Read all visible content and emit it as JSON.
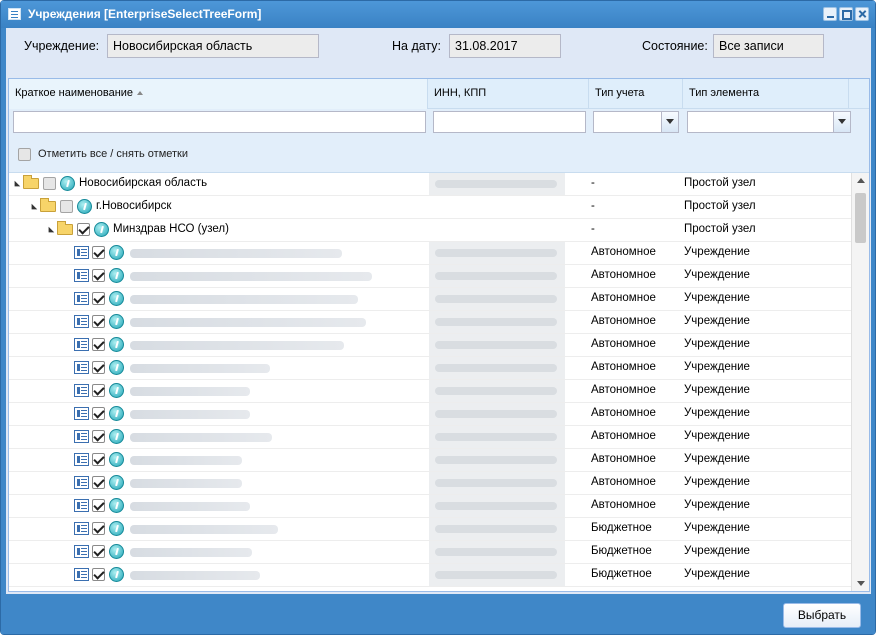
{
  "window": {
    "title": "Учреждения [EnterpriseSelectTreeForm]"
  },
  "filters": {
    "institution_label": "Учреждение:",
    "institution_value": "Новосибирская область",
    "date_label": "На дату:",
    "date_value": "31.08.2017",
    "state_label": "Состояние:",
    "state_value": "Все записи"
  },
  "grid": {
    "columns": [
      "Краткое наименование",
      "ИНН, КПП",
      "Тип учета",
      "Тип элемента"
    ],
    "sort_column": "Краткое наименование",
    "check_all_label": "Отметить все / снять отметки",
    "rows": [
      {
        "level": 0,
        "kind": "folder",
        "checked": false,
        "name": "Новосибирская область",
        "inn": "",
        "tip": "-",
        "type": "Простой узел"
      },
      {
        "level": 1,
        "kind": "folder",
        "checked": false,
        "name": "г.Новосибирск",
        "inn": "",
        "tip": "-",
        "type": "Простой узел"
      },
      {
        "level": 2,
        "kind": "folder",
        "checked": true,
        "name": "Минздрав НСО (узел)",
        "inn": "",
        "tip": "-",
        "type": "Простой узел"
      },
      {
        "level": 3,
        "kind": "leaf",
        "checked": true,
        "name": "",
        "inn": "",
        "tip": "Автономное",
        "type": "Учреждение"
      },
      {
        "level": 3,
        "kind": "leaf",
        "checked": true,
        "name": "",
        "inn": "",
        "tip": "Автономное",
        "type": "Учреждение"
      },
      {
        "level": 3,
        "kind": "leaf",
        "checked": true,
        "name": "",
        "inn": "",
        "tip": "Автономное",
        "type": "Учреждение"
      },
      {
        "level": 3,
        "kind": "leaf",
        "checked": true,
        "name": "",
        "inn": "",
        "tip": "Автономное",
        "type": "Учреждение"
      },
      {
        "level": 3,
        "kind": "leaf",
        "checked": true,
        "name": "",
        "inn": "",
        "tip": "Автономное",
        "type": "Учреждение"
      },
      {
        "level": 3,
        "kind": "leaf",
        "checked": true,
        "name": "",
        "inn": "",
        "tip": "Автономное",
        "type": "Учреждение"
      },
      {
        "level": 3,
        "kind": "leaf",
        "checked": true,
        "name": "",
        "inn": "",
        "tip": "Автономное",
        "type": "Учреждение"
      },
      {
        "level": 3,
        "kind": "leaf",
        "checked": true,
        "name": "",
        "inn": "",
        "tip": "Автономное",
        "type": "Учреждение"
      },
      {
        "level": 3,
        "kind": "leaf",
        "checked": true,
        "name": "",
        "inn": "",
        "tip": "Автономное",
        "type": "Учреждение"
      },
      {
        "level": 3,
        "kind": "leaf",
        "checked": true,
        "name": "",
        "inn": "",
        "tip": "Автономное",
        "type": "Учреждение"
      },
      {
        "level": 3,
        "kind": "leaf",
        "checked": true,
        "name": "",
        "inn": "",
        "tip": "Автономное",
        "type": "Учреждение"
      },
      {
        "level": 3,
        "kind": "leaf",
        "checked": true,
        "name": "",
        "inn": "",
        "tip": "Автономное",
        "type": "Учреждение"
      },
      {
        "level": 3,
        "kind": "leaf",
        "checked": true,
        "name": "",
        "inn": "",
        "tip": "Бюджетное",
        "type": "Учреждение"
      },
      {
        "level": 3,
        "kind": "leaf",
        "checked": true,
        "name": "",
        "inn": "",
        "tip": "Бюджетное",
        "type": "Учреждение"
      },
      {
        "level": 3,
        "kind": "leaf",
        "checked": true,
        "name": "",
        "inn": "",
        "tip": "Бюджетное",
        "type": "Учреждение"
      }
    ]
  },
  "footer": {
    "select_label": "Выбрать"
  }
}
